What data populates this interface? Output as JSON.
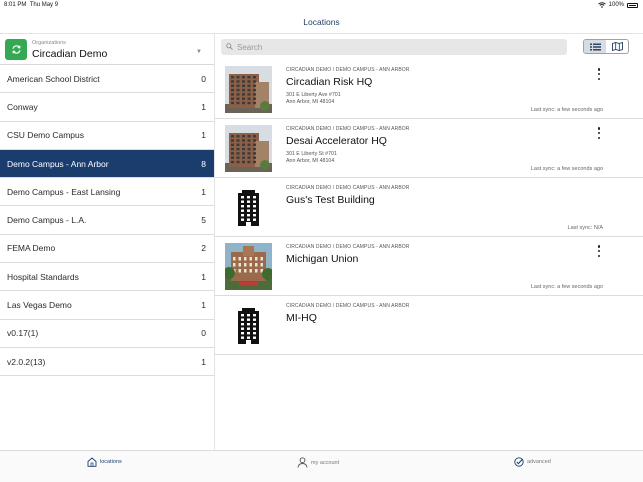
{
  "status_bar": {
    "time": "8:01 PM",
    "date": "Thu May 9",
    "battery": "100%"
  },
  "nav": {
    "title": "Locations"
  },
  "organization": {
    "label": "Organizations",
    "name": "Circadian Demo"
  },
  "campuses": [
    {
      "name": "American School District",
      "count": "0"
    },
    {
      "name": "Conway",
      "count": "1"
    },
    {
      "name": "CSU Demo Campus",
      "count": "1"
    },
    {
      "name": "Demo Campus - Ann Arbor",
      "count": "8",
      "selected": true
    },
    {
      "name": "Demo Campus - East Lansing",
      "count": "1"
    },
    {
      "name": "Demo Campus - L.A.",
      "count": "5"
    },
    {
      "name": "FEMA Demo",
      "count": "2"
    },
    {
      "name": "Hospital Standards",
      "count": "1"
    },
    {
      "name": "Las Vegas Demo",
      "count": "1"
    },
    {
      "name": "v0.17(1)",
      "count": "0"
    },
    {
      "name": "v2.0.2(13)",
      "count": "1"
    }
  ],
  "search": {
    "placeholder": "Search",
    "value": ""
  },
  "view_toggle": {
    "active": "list",
    "options": [
      "list-icon",
      "map-icon"
    ]
  },
  "locations": [
    {
      "path": "CIRCADIAN DEMO / DEMO CAMPUS - ANN ARBOR",
      "name": "Circadian Risk HQ",
      "address1": "301 E Liberty Ave #701",
      "address2": "Ann Arbor, MI 48104",
      "sync": "Last sync: a few seconds ago",
      "thumb": "photo-tower",
      "has_menu": true
    },
    {
      "path": "CIRCADIAN DEMO / DEMO CAMPUS - ANN ARBOR",
      "name": "Desai Accelerator HQ",
      "address1": "301 E Liberty St #701",
      "address2": "Ann Arbor, MI 48104",
      "sync": "Last sync: a few seconds ago",
      "thumb": "photo-tower",
      "has_menu": true
    },
    {
      "path": "CIRCADIAN DEMO / DEMO CAMPUS - ANN ARBOR",
      "name": "Gus's Test Building",
      "address1": "",
      "address2": "",
      "sync": "Last sync: N/A",
      "thumb": "building-icon",
      "has_menu": false
    },
    {
      "path": "CIRCADIAN DEMO / DEMO CAMPUS - ANN ARBOR",
      "name": "Michigan Union",
      "address1": "",
      "address2": "",
      "sync": "Last sync: a few seconds ago",
      "thumb": "photo-union",
      "has_menu": true
    },
    {
      "path": "CIRCADIAN DEMO / DEMO CAMPUS - ANN ARBOR",
      "name": "MI-HQ",
      "address1": "",
      "address2": "",
      "sync": "",
      "thumb": "building-icon",
      "has_menu": false
    }
  ],
  "tabs": [
    {
      "label": "locations",
      "icon": "home-icon",
      "active": true
    },
    {
      "label": "my account",
      "icon": "user-icon",
      "active": false
    },
    {
      "label": "advanced",
      "icon": "check-circle-icon",
      "active": false
    }
  ],
  "colors": {
    "selected": "#1b3d6e",
    "org_button": "#35a853",
    "title": "#1f3a5f"
  }
}
